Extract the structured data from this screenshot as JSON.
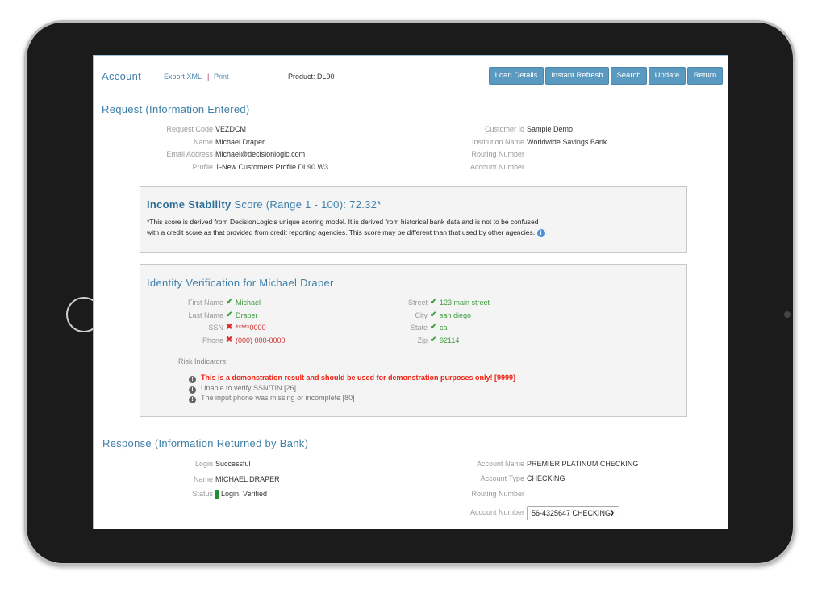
{
  "header": {
    "title": "Account",
    "export_xml": "Export XML",
    "separator": "|",
    "print": "Print",
    "product": "Product: DL90",
    "buttons": [
      "Loan Details",
      "Instant Refresh",
      "Search",
      "Update",
      "Return"
    ]
  },
  "request": {
    "heading": "Request (Information Entered)",
    "left": [
      {
        "label": "Request Code",
        "value": "VEZDCM"
      },
      {
        "label": "Name",
        "value": "Michael Draper"
      },
      {
        "label": "Email Address",
        "value": "Michael@decisionlogic.com"
      },
      {
        "label": "Profile",
        "value": "1-New Customers Profile DL90 W3"
      }
    ],
    "right": [
      {
        "label": "Customer Id",
        "value": "Sample Demo"
      },
      {
        "label": "Institution Name",
        "value": "Worldwide Savings Bank"
      },
      {
        "label": "Routing Number",
        "value": ""
      },
      {
        "label": "Account Number",
        "value": ""
      }
    ]
  },
  "income": {
    "title_bold": "Income Stability",
    "title_rest": "Score (Range 1 - 100): 72.32*",
    "note": "*This score is derived from DecisionLogic's unique scoring model. It is derived from historical bank data and is not to be confused with a credit score as that provided from credit reporting agencies. This score may be different than that used by other agencies."
  },
  "identity": {
    "heading": "Identity Verification for Michael Draper",
    "left": [
      {
        "label": "First Name",
        "value": "Michael",
        "ok": true
      },
      {
        "label": "Last Name",
        "value": "Draper",
        "ok": true
      },
      {
        "label": "SSN",
        "value": "*****0000",
        "ok": false
      },
      {
        "label": "Phone",
        "value": "(000) 000-0000",
        "ok": false
      }
    ],
    "right": [
      {
        "label": "Street",
        "value": "123 main street",
        "ok": true
      },
      {
        "label": "City",
        "value": "san diego",
        "ok": true
      },
      {
        "label": "State",
        "value": "ca",
        "ok": true
      },
      {
        "label": "Zip",
        "value": "92114",
        "ok": true
      }
    ],
    "risk_label": "Risk Indicators:",
    "risks": [
      "This is a demonstration result and should be used for demonstration purposes only! [9999]",
      "Unable to verify SSN/TIN [26]",
      "The input phone was missing or incomplete [80]"
    ]
  },
  "response": {
    "heading": "Response (Information Returned by Bank)",
    "left": [
      {
        "label": "Login",
        "value": "Successful"
      },
      {
        "label": "Name",
        "value": "MICHAEL DRAPER"
      },
      {
        "label": "Status",
        "value": "Login, Verified"
      }
    ],
    "right": [
      {
        "label": "Account Name",
        "value": "PREMIER PLATINUM CHECKING"
      },
      {
        "label": "Account Type",
        "value": "CHECKING"
      },
      {
        "label": "Routing Number",
        "value": ""
      },
      {
        "label": "Account Number",
        "value": "56-4325647 CHECKING"
      }
    ]
  },
  "colors": {
    "accent": "#5b9ac0",
    "heading": "#3f7fa8",
    "ok": "#3aa03a",
    "error": "#d33333",
    "status": "#1f8f2f"
  }
}
